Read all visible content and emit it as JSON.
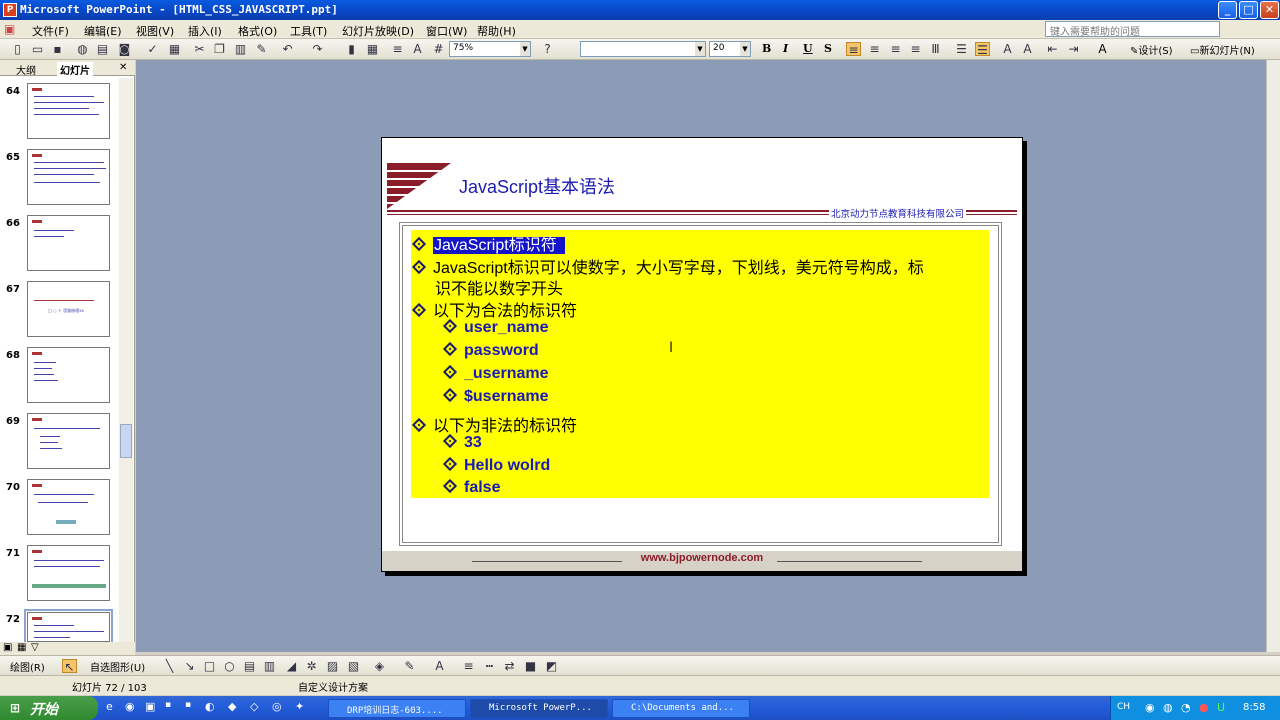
{
  "window": {
    "title": "Microsoft PowerPoint - [HTML_CSS_JAVASCRIPT.ppt]",
    "min": "_",
    "max": "□",
    "close": "✕"
  },
  "menubar": {
    "items": [
      "文件(F)",
      "编辑(E)",
      "视图(V)",
      "插入(I)",
      "格式(O)",
      "工具(T)",
      "幻灯片放映(D)",
      "窗口(W)",
      "帮助(H)"
    ],
    "help_placeholder": "键入需要帮助的问题"
  },
  "toolbar": {
    "zoom": "75%",
    "font_name": "",
    "font_size": "20",
    "bold": "B",
    "italic": "I",
    "underline": "U",
    "shadow": "S",
    "design_label": "设计(S)",
    "new_slide_label": "新幻灯片(N)"
  },
  "panel": {
    "tab_outline": "大纲",
    "tab_slides": "幻灯片",
    "close": "✕",
    "slide_numbers": [
      "64",
      "65",
      "66",
      "67",
      "68",
      "69",
      "70",
      "71",
      "72"
    ],
    "thumb67_text": "□ ○ ＋ 思路梳理xx"
  },
  "slide": {
    "title": "JavaScript基本语法",
    "company": "北京动力节点教育科技有限公司",
    "footer": "www.bjpowernode.com",
    "bullets": [
      {
        "level": 1,
        "text": "JavaScript标识符",
        "selected": true
      },
      {
        "level": 1,
        "text": "JavaScript标识可以使数字，大小写字母，下划线，美元符号构成，标",
        "cont": "识不能以数字开头"
      },
      {
        "level": 1,
        "text": "以下为合法的标识符"
      },
      {
        "level": 2,
        "text": "user_name"
      },
      {
        "level": 2,
        "text": "password"
      },
      {
        "level": 2,
        "text": "_username"
      },
      {
        "level": 2,
        "text": "$username"
      },
      {
        "level": 1,
        "text": "以下为非法的标识符"
      },
      {
        "level": 2,
        "text": "33"
      },
      {
        "level": 2,
        "text": "Hello wolrd"
      },
      {
        "level": 2,
        "text": "false"
      }
    ]
  },
  "drawbar": {
    "draw_label": "绘图(R)",
    "autoshapes_label": "自选图形(U)"
  },
  "statusbar": {
    "slide_info": "幻灯片 72 / 103",
    "design": "自定义设计方案"
  },
  "taskbar": {
    "start": "开始",
    "tasks": [
      "DRP培训日志-603....",
      "Microsoft PowerP...",
      "C:\\Documents and..."
    ],
    "lang": "CH",
    "clock": "8:58"
  },
  "colors": {
    "slide_title": "#1b1bb4",
    "highlight": "#ffff00",
    "brand_red": "#8b1d2a"
  }
}
